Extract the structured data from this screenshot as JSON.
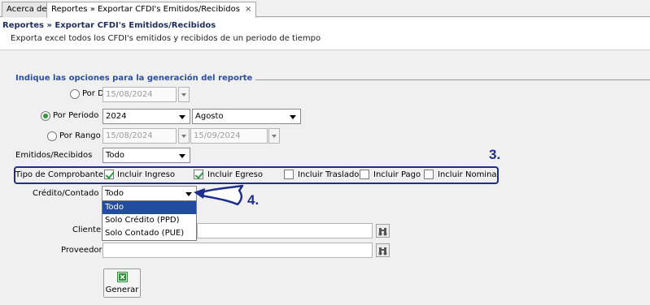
{
  "tabs": [
    {
      "label": "Acerca de",
      "active": false
    },
    {
      "label": "Reportes » Exportar CFDI's Emitidos/Recibidos",
      "active": true,
      "close": "×"
    }
  ],
  "header": {
    "title": "Reportes » Exportar CFDI's Emitidos/Recibidos",
    "subtitle": "Exporta excel todos los CFDI's emitidos y recibidos de un periodo de tiempo"
  },
  "form": {
    "section_title": "Indique las opciones para la generación del reporte",
    "por_dia": {
      "label": "Por Día",
      "selected": false,
      "date": "15/08/2024"
    },
    "por_periodo": {
      "label": "Por Periodo",
      "selected": true,
      "year": "2024",
      "month": "Agosto"
    },
    "por_rango": {
      "label": "Por Rango",
      "selected": false,
      "from": "15/08/2024",
      "to": "15/09/2024"
    },
    "emitidos_recibidos": {
      "label": "Emitidos/Recibidos",
      "value": "Todo"
    },
    "tipo_comprobante": {
      "label": "Tipo de Comprobante",
      "options": [
        {
          "label": "Incluir Ingreso",
          "checked": true
        },
        {
          "label": "Incluir Egreso",
          "checked": true
        },
        {
          "label": "Incluir Traslado",
          "checked": false
        },
        {
          "label": "Incluir Pago",
          "checked": false
        },
        {
          "label": "Incluir Nomina",
          "checked": false
        }
      ]
    },
    "credito_contado": {
      "label": "Crédito/Contado",
      "value": "Todo",
      "options": [
        "Todo",
        "Solo Crédito (PPD)",
        "Solo Contado (PUE)"
      ],
      "selected_index": 0
    },
    "cliente": {
      "label": "Cliente",
      "value": ""
    },
    "proveedor": {
      "label": "Proveedor",
      "value": ""
    },
    "generar_label": "Generar"
  },
  "annotations": {
    "step3": "3.",
    "step4": "4."
  },
  "colors": {
    "accent": "#1d2e8f",
    "section_title": "#2a4fa1",
    "check": "#2e9a3a",
    "selection": "#244c9e"
  }
}
